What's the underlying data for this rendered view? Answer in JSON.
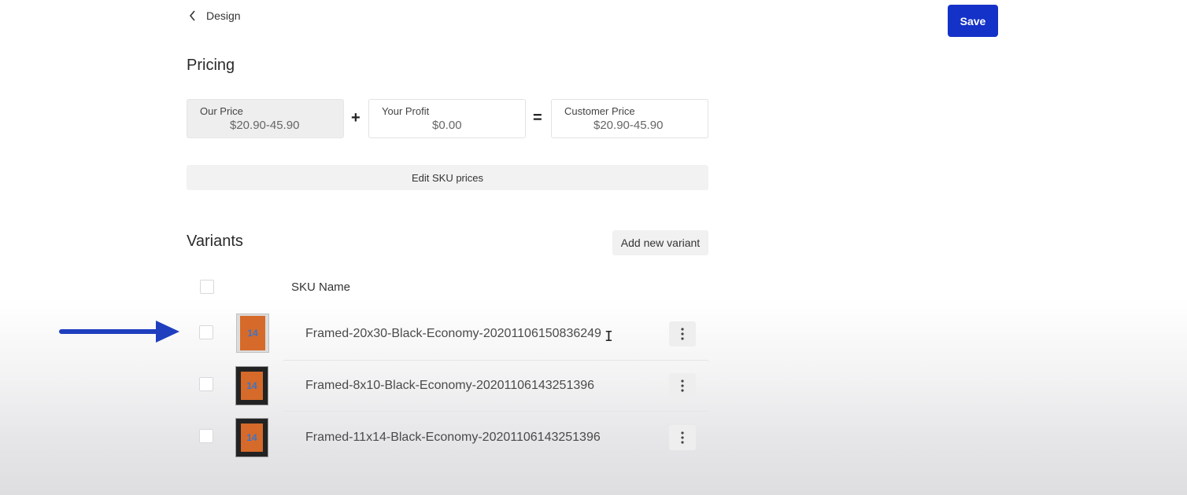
{
  "header": {
    "back_label": "Design",
    "save_label": "Save"
  },
  "pricing": {
    "title": "Pricing",
    "our_price": {
      "label": "Our Price",
      "value": "$20.90-45.90"
    },
    "plus": "+",
    "your_profit": {
      "label": "Your Profit",
      "value": "$0.00"
    },
    "equals": "=",
    "customer_price": {
      "label": "Customer Price",
      "value": "$20.90-45.90"
    },
    "edit_sku_label": "Edit SKU prices"
  },
  "variants": {
    "title": "Variants",
    "add_label": "Add new variant",
    "column_sku_name": "SKU Name",
    "rows": [
      {
        "name": "Framed-20x30-Black-Economy-20201106150836249",
        "thumb_text": "14"
      },
      {
        "name": "Framed-8x10-Black-Economy-20201106143251396",
        "thumb_text": "14"
      },
      {
        "name": "Framed-11x14-Black-Economy-20201106143251396",
        "thumb_text": "14"
      }
    ]
  },
  "colors": {
    "accent": "#1432c8",
    "arrow": "#1f3fbf",
    "thumb_orange": "#d66a2a"
  },
  "icons": {
    "back": "chevron-left-icon",
    "row_menu": "more-vertical-icon",
    "annotation": "arrow-right-icon"
  }
}
